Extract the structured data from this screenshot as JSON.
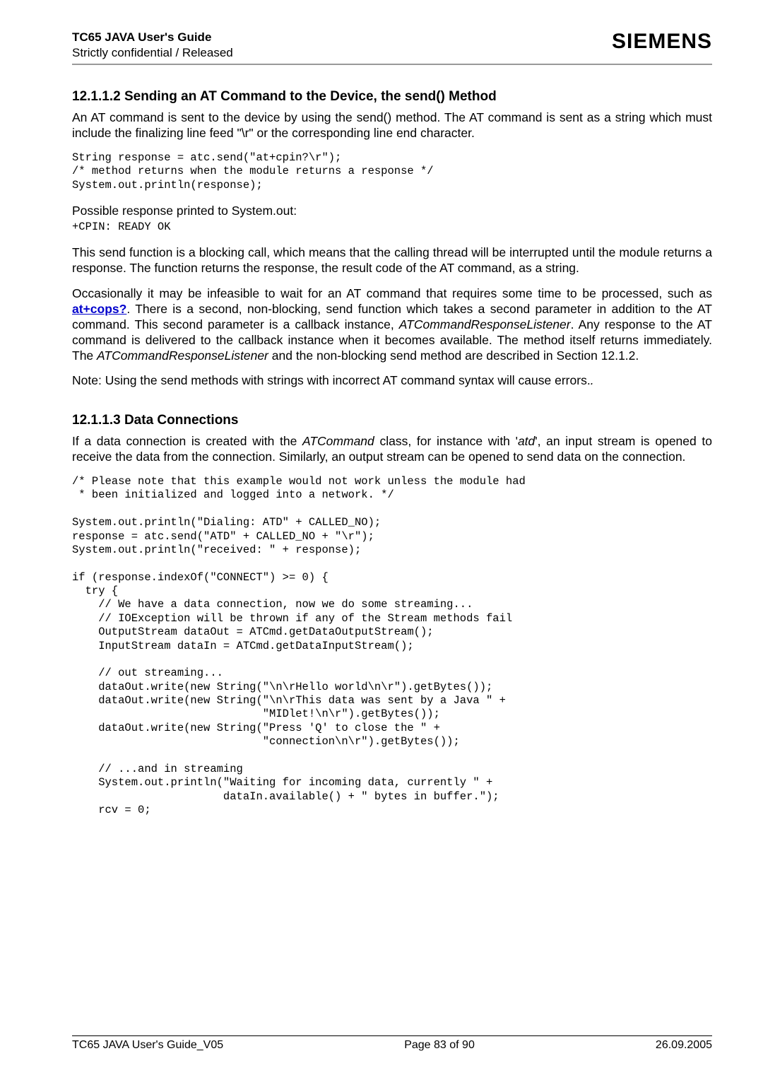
{
  "header": {
    "title": "TC65 JAVA User's Guide",
    "subtitle": "Strictly confidential / Released",
    "brand": "SIEMENS"
  },
  "section1": {
    "number_title": "12.1.1.2   Sending an AT Command to the Device, the send() Method",
    "para1": "An AT command is sent to the device by using the send() method. The AT command is sent as a string which must include the finalizing line feed \"\\r\" or the corresponding line end character.",
    "code1": "String response = atc.send(\"at+cpin?\\r\");\n/* method returns when the module returns a response */\nSystem.out.println(response);",
    "para2": "Possible response printed to System.out:",
    "code2": "+CPIN: READY OK",
    "para3": "This send function is a blocking call, which means that the calling thread will be interrupted until the module returns a response. The function returns the response, the result code of the AT command, as a string.",
    "para4a": "Occasionally it may be infeasible to wait for an AT command that requires some time to be processed, such as ",
    "link": "at+cops?",
    "para4b": ". There is a second, non-blocking, send function which takes a second parameter in addition to the AT command. This second parameter is a callback instance, ",
    "italic1": "ATCommandResponseListener",
    "para4c": ".  Any response to the AT command is delivered to the callback instance when it becomes available. The method itself returns immediately. The ",
    "italic2": "ATCommandResponseListener",
    "para4d": " and the non-blocking send method are described in Section 12.1.2.",
    "para5": "Note: Using the send methods with strings with incorrect AT command syntax will cause errors."
  },
  "section2": {
    "number_title": "12.1.1.3   Data Connections",
    "para1a": "If a data connection is created with the ",
    "italic1": "ATCommand",
    "para1b": " class, for instance with '",
    "italic2": "atd",
    "para1c": "', an input stream is opened to receive the data from the connection. Similarly, an output stream can be opened to send data on the connection.",
    "code": "/* Please note that this example would not work unless the module had\n * been initialized and logged into a network. */\n\nSystem.out.println(\"Dialing: ATD\" + CALLED_NO);\nresponse = atc.send(\"ATD\" + CALLED_NO + \"\\r\");\nSystem.out.println(\"received: \" + response);\n\nif (response.indexOf(\"CONNECT\") >= 0) {\n  try {\n    // We have a data connection, now we do some streaming...\n    // IOException will be thrown if any of the Stream methods fail\n    OutputStream dataOut = ATCmd.getDataOutputStream();\n    InputStream dataIn = ATCmd.getDataInputStream();\n\n    // out streaming...\n    dataOut.write(new String(\"\\n\\rHello world\\n\\r\").getBytes());\n    dataOut.write(new String(\"\\n\\rThis data was sent by a Java \" +\n                             \"MIDlet!\\n\\r\").getBytes());\n    dataOut.write(new String(\"Press 'Q' to close the \" +\n                             \"connection\\n\\r\").getBytes());\n\n    // ...and in streaming\n    System.out.println(\"Waiting for incoming data, currently \" +\n                       dataIn.available() + \" bytes in buffer.\");\n    rcv = 0;"
  },
  "footer": {
    "left": "TC65 JAVA User's Guide_V05",
    "center": "Page 83 of 90",
    "right": "26.09.2005"
  }
}
